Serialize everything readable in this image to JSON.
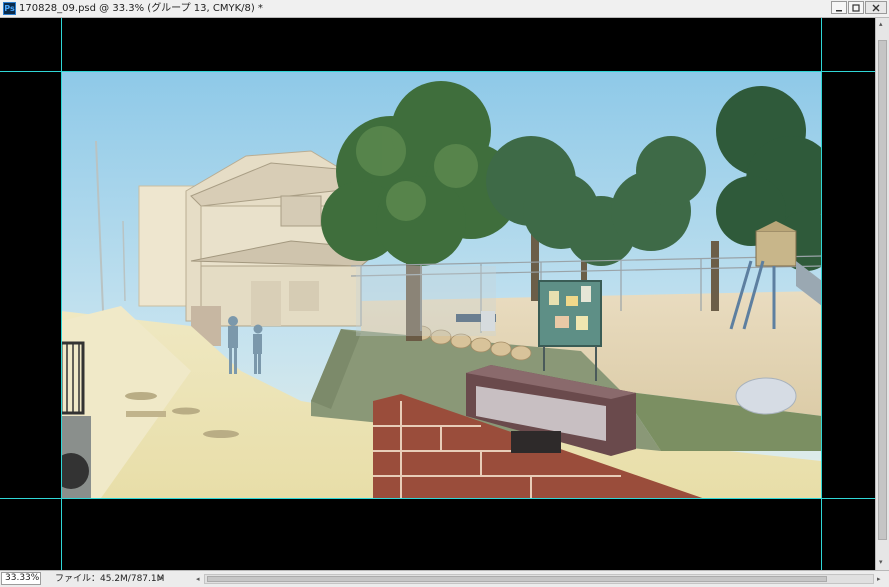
{
  "window": {
    "title": "170828_09.psd @ 33.3% (グループ 13, CMYK/8) *",
    "app_icon_label": "Ps",
    "controls": [
      "minimize-icon",
      "maximize-icon",
      "close-icon"
    ]
  },
  "canvas": {
    "background": "#000000",
    "guide_color": "#2fd6d6",
    "artwork_description": "anime-style background painting"
  },
  "statusbar": {
    "zoom": "33.33%",
    "file_info": "ファイル：45.2M/787.1M",
    "menu_arrow": ">"
  },
  "scrollbars": {
    "left_arrow": "◂",
    "right_arrow": "▸",
    "up_arrow": "▴",
    "down_arrow": "▾"
  }
}
